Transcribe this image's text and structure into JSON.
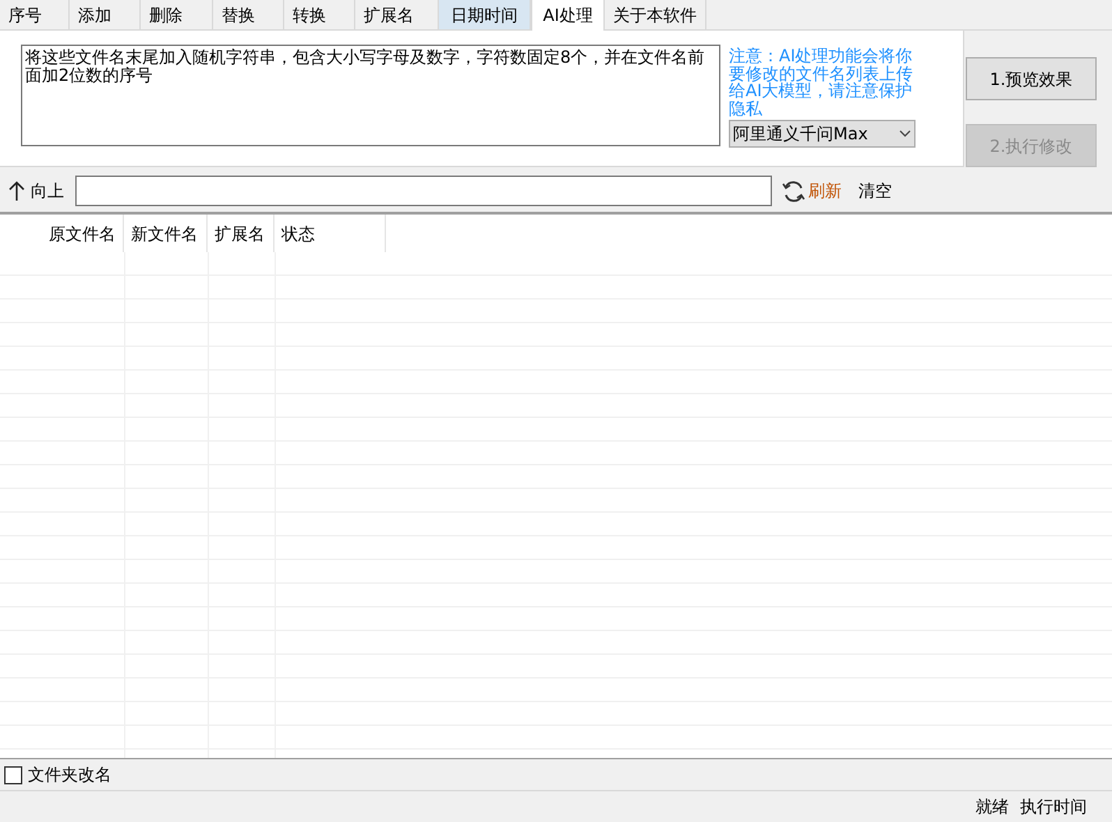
{
  "tabs": [
    {
      "label": "序号",
      "selected": false,
      "hovered": false
    },
    {
      "label": "添加",
      "selected": false,
      "hovered": false
    },
    {
      "label": "删除",
      "selected": false,
      "hovered": false
    },
    {
      "label": "替换",
      "selected": false,
      "hovered": false
    },
    {
      "label": "转换",
      "selected": false,
      "hovered": false
    },
    {
      "label": "扩展名",
      "selected": false,
      "hovered": false
    },
    {
      "label": "日期时间",
      "selected": false,
      "hovered": true
    },
    {
      "label": "AI处理",
      "selected": true,
      "hovered": false
    },
    {
      "label": "关于本软件",
      "selected": false,
      "hovered": false
    }
  ],
  "prompt": {
    "value": "将这些文件名末尾加入随机字符串，包含大小写字母及数字，字符数固定8个，并在文件名前面加2位数的序号"
  },
  "notice": "注意：AI处理功能会将你要修改的文件名列表上传给AI大模型，请注意保护隐私",
  "model_select": {
    "value": "阿里通义千问Max"
  },
  "buttons": [
    {
      "label": "1.预览效果",
      "disabled": false
    },
    {
      "label": "2.执行修改",
      "disabled": true
    }
  ],
  "toolbar": {
    "up": "向上",
    "refresh": "刷新",
    "clear": "清空"
  },
  "table": {
    "columns": [
      "原文件名",
      "新文件名",
      "扩展名",
      "状态"
    ]
  },
  "folder_rename": {
    "label": "文件夹改名",
    "checked": false
  },
  "status_bar": [
    "就绪",
    "执行时间"
  ]
}
